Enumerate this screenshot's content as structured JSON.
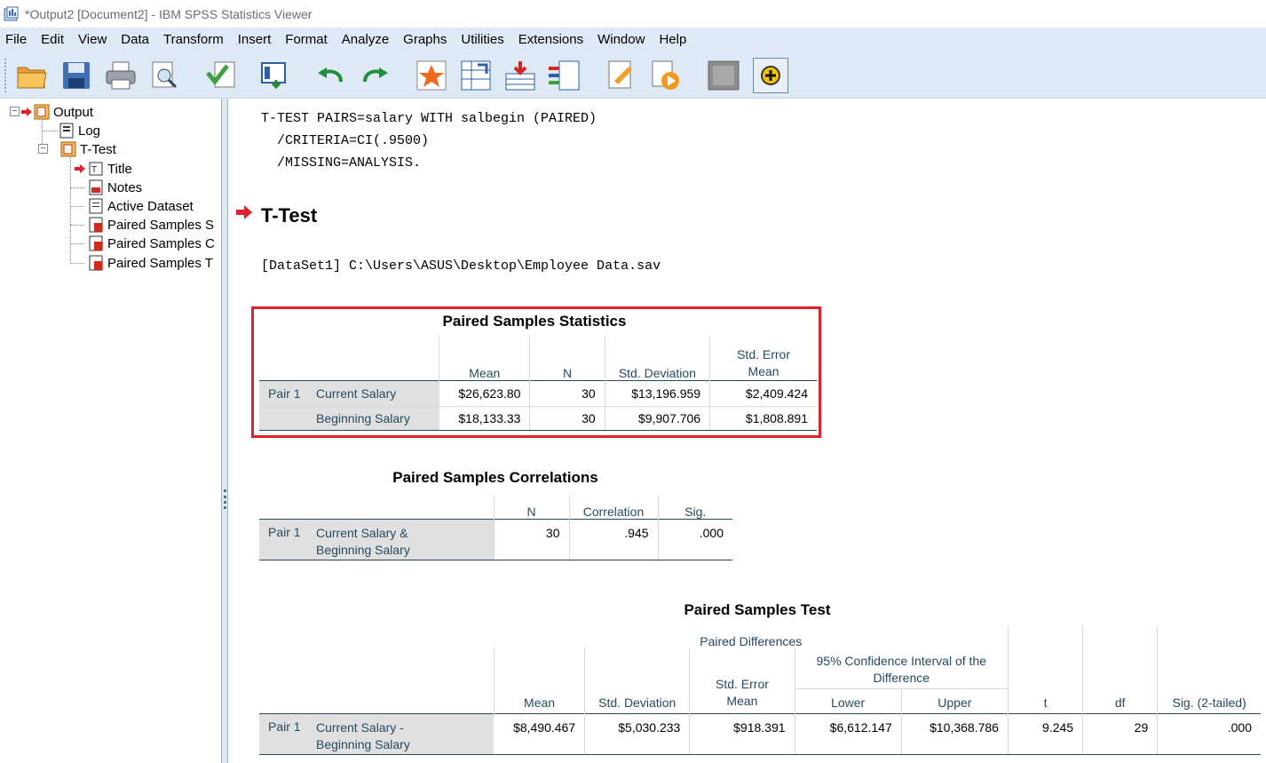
{
  "window": {
    "title": "*Output2 [Document2] - IBM SPSS Statistics Viewer"
  },
  "menu": [
    "File",
    "Edit",
    "View",
    "Data",
    "Transform",
    "Insert",
    "Format",
    "Analyze",
    "Graphs",
    "Utilities",
    "Extensions",
    "Window",
    "Help"
  ],
  "toolbar": {
    "icons": [
      "open-folder-icon",
      "save-icon",
      "print-icon",
      "print-preview-icon",
      "export-icon",
      "recall-dialog-icon",
      "undo-icon",
      "redo-icon",
      "goto-case-icon",
      "goto-variable-icon",
      "insert-cases-icon",
      "variables-icon",
      "designate-window-icon",
      "run-script-icon",
      "hide-icon",
      "promote-icon"
    ]
  },
  "outline": {
    "root": "Output",
    "log": "Log",
    "ttest": "T-Test",
    "children": [
      "Title",
      "Notes",
      "Active Dataset",
      "Paired Samples S",
      "Paired Samples C",
      "Paired Samples T"
    ]
  },
  "syntax": [
    "T-TEST PAIRS=salary WITH salbegin (PAIRED)",
    "  /CRITERIA=CI(.9500)",
    "  /MISSING=ANALYSIS."
  ],
  "heading": "T-Test",
  "dataset": "[DataSet1] C:\\Users\\ASUS\\Desktop\\Employee Data.sav",
  "stats_table": {
    "title": "Paired Samples Statistics",
    "headers": [
      "Mean",
      "N",
      "Std. Deviation",
      "Std. Error\nMean"
    ],
    "pair_label": "Pair 1",
    "rows": [
      {
        "label": "Current Salary",
        "mean": "$26,623.80",
        "n": "30",
        "sd": "$13,196.959",
        "se": "$2,409.424"
      },
      {
        "label": "Beginning Salary",
        "mean": "$18,133.33",
        "n": "30",
        "sd": "$9,907.706",
        "se": "$1,808.891"
      }
    ]
  },
  "corr_table": {
    "title": "Paired Samples Correlations",
    "headers": [
      "N",
      "Correlation",
      "Sig."
    ],
    "pair_label": "Pair 1",
    "row": {
      "label_line1": "Current Salary &",
      "label_line2": "Beginning Salary",
      "n": "30",
      "corr": ".945",
      "sig": ".000"
    }
  },
  "test_table": {
    "title": "Paired Samples Test",
    "group_header": "Paired Differences",
    "ci_header_line1": "95% Confidence Interval of the",
    "ci_header_line2": "Difference",
    "headers": {
      "mean": "Mean",
      "sd": "Std. Deviation",
      "se_line1": "Std. Error",
      "se_line2": "Mean",
      "lower": "Lower",
      "upper": "Upper",
      "t": "t",
      "df": "df",
      "sig": "Sig. (2-tailed)"
    },
    "pair_label": "Pair 1",
    "row": {
      "label_line1": "Current Salary -",
      "label_line2": "Beginning Salary",
      "mean": "$8,490.467",
      "sd": "$5,030.233",
      "se": "$918.391",
      "lower": "$6,612.147",
      "upper": "$10,368.786",
      "t": "9.245",
      "df": "29",
      "sig": ".000"
    }
  },
  "colors": {
    "highlight": "#e0202a",
    "header_text": "#264a60",
    "menubar_bg": "#dde9f5"
  }
}
